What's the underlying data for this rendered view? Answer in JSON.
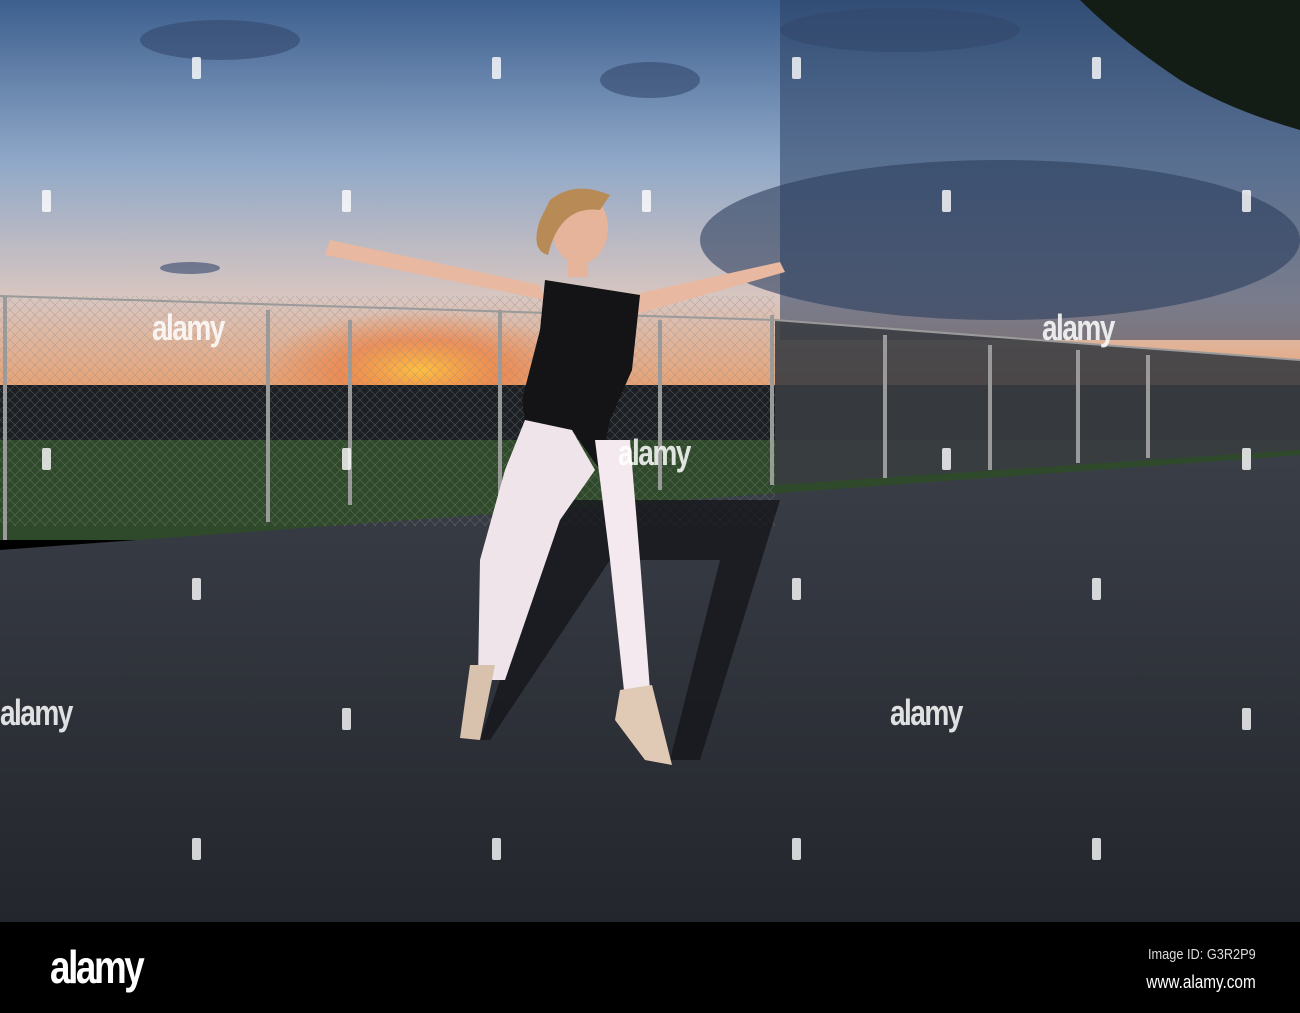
{
  "photo": {
    "subject": "ballerina",
    "watermark_text": "alamy"
  },
  "footer": {
    "logo": "alamy",
    "image_id": "Image ID: G3R2P9",
    "website": "www.alamy.com"
  },
  "colors": {
    "sky_top": "#3a5e8c",
    "sunset": "#f0a050",
    "asphalt": "#2b2e35",
    "footer": "#000000"
  }
}
